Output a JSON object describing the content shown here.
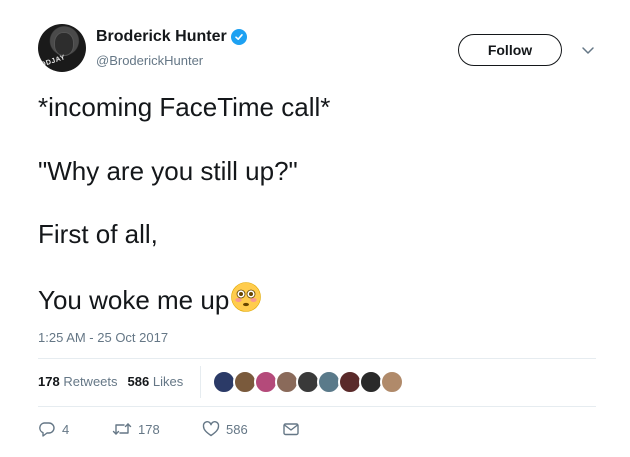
{
  "user": {
    "display_name": "Broderick Hunter",
    "handle": "@BroderickHunter",
    "avatar_text": "ODJAY",
    "verified_icon": "verified-badge-icon"
  },
  "follow_label": "Follow",
  "tweet_lines": [
    "*incoming FaceTime call*",
    "\"Why are you still up?\"",
    "First of all,",
    "You woke me up"
  ],
  "emoji": "flushed-face-icon",
  "timestamp": "1:25 AM - 25 Oct 2017",
  "stats": {
    "retweets_count": "178",
    "retweets_label": "Retweets",
    "likes_count": "586",
    "likes_label": "Likes"
  },
  "likers_colors": [
    "#2b3a67",
    "#7a5a3c",
    "#b44a7a",
    "#8a6a5a",
    "#3a3a3a",
    "#5a7a8a",
    "#5a2a2a",
    "#2a2a2a",
    "#b08a6a"
  ],
  "actions": {
    "reply_count": "4",
    "retweet_count": "178",
    "like_count": "586"
  },
  "colors": {
    "text": "#14171a",
    "secondary": "#657786",
    "verified": "#1da1f2",
    "divider": "#e6ecf0"
  }
}
